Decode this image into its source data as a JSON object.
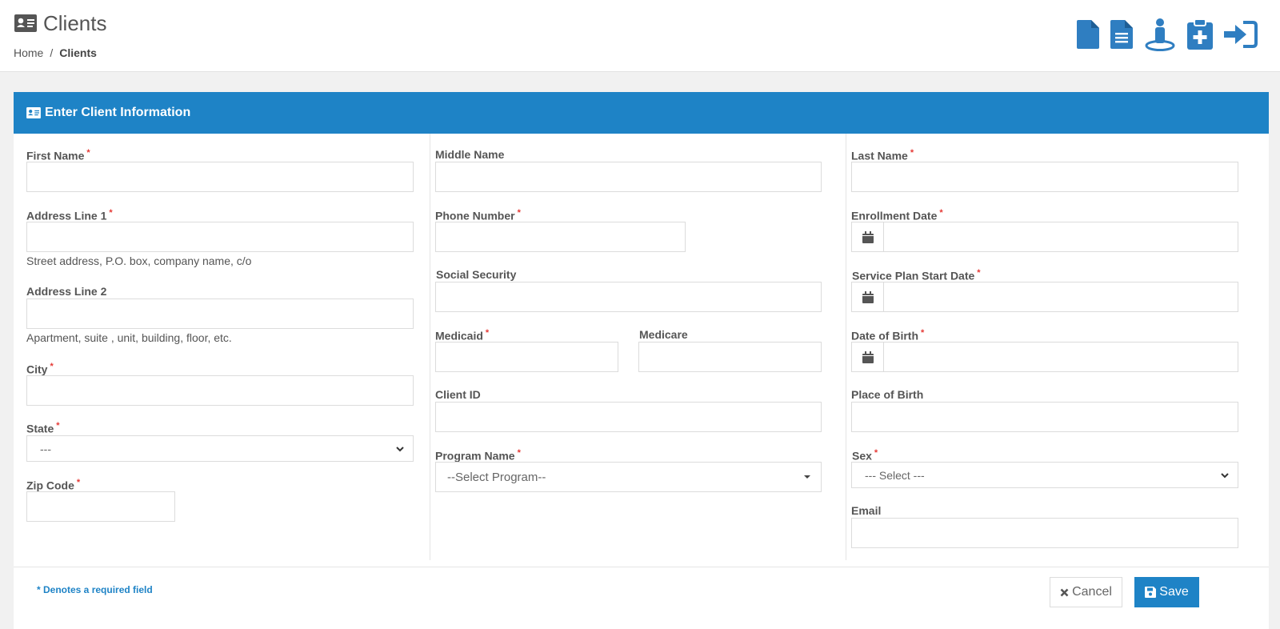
{
  "header": {
    "title": "Clients",
    "breadcrumb": {
      "home": "Home",
      "separator": "/",
      "current": "Clients"
    },
    "icons": [
      "document-icon",
      "document-list-icon",
      "person-location-icon",
      "clipboard-medical-icon",
      "sign-in-icon"
    ]
  },
  "panel": {
    "title": "Enter Client Information",
    "accent": "#1e83c6"
  },
  "form": {
    "first_name": {
      "label": "First Name",
      "required": "*",
      "value": ""
    },
    "address1": {
      "label": "Address Line 1",
      "required": "*",
      "value": "",
      "help": "Street address, P.O. box, company name, c/o"
    },
    "address2": {
      "label": "Address Line 2",
      "value": "",
      "help": "Apartment, suite , unit, building, floor, etc."
    },
    "city": {
      "label": "City",
      "required": "*",
      "value": ""
    },
    "state": {
      "label": "State",
      "required": "*",
      "selected": "---"
    },
    "zip": {
      "label": "Zip Code",
      "required": "*",
      "value": ""
    },
    "middle_name": {
      "label": "Middle Name",
      "value": ""
    },
    "phone": {
      "label": "Phone Number",
      "required": "*",
      "value": ""
    },
    "ssn": {
      "label": "Social Security",
      "value": ""
    },
    "medicaid": {
      "label": "Medicaid",
      "required": "*",
      "value": ""
    },
    "medicare": {
      "label": "Medicare",
      "value": ""
    },
    "client_id": {
      "label": "Client ID",
      "value": ""
    },
    "program": {
      "label": "Program Name",
      "required": "*",
      "selected": "--Select Program--"
    },
    "last_name": {
      "label": "Last Name",
      "required": "*",
      "value": ""
    },
    "enrollment_date": {
      "label": "Enrollment Date",
      "required": "*",
      "value": ""
    },
    "service_plan_start": {
      "label": "Service Plan Start Date",
      "required": "*",
      "value": ""
    },
    "dob": {
      "label": "Date of Birth",
      "required": "*",
      "value": ""
    },
    "place_of_birth": {
      "label": "Place of Birth",
      "value": ""
    },
    "sex": {
      "label": "Sex",
      "required": "*",
      "selected": "--- Select ---"
    },
    "email": {
      "label": "Email",
      "value": ""
    }
  },
  "footer": {
    "note": "* Denotes a required field",
    "cancel_label": "Cancel",
    "save_label": "Save"
  },
  "colors": {
    "brand": "#1e83c6",
    "required": "#e53935"
  }
}
